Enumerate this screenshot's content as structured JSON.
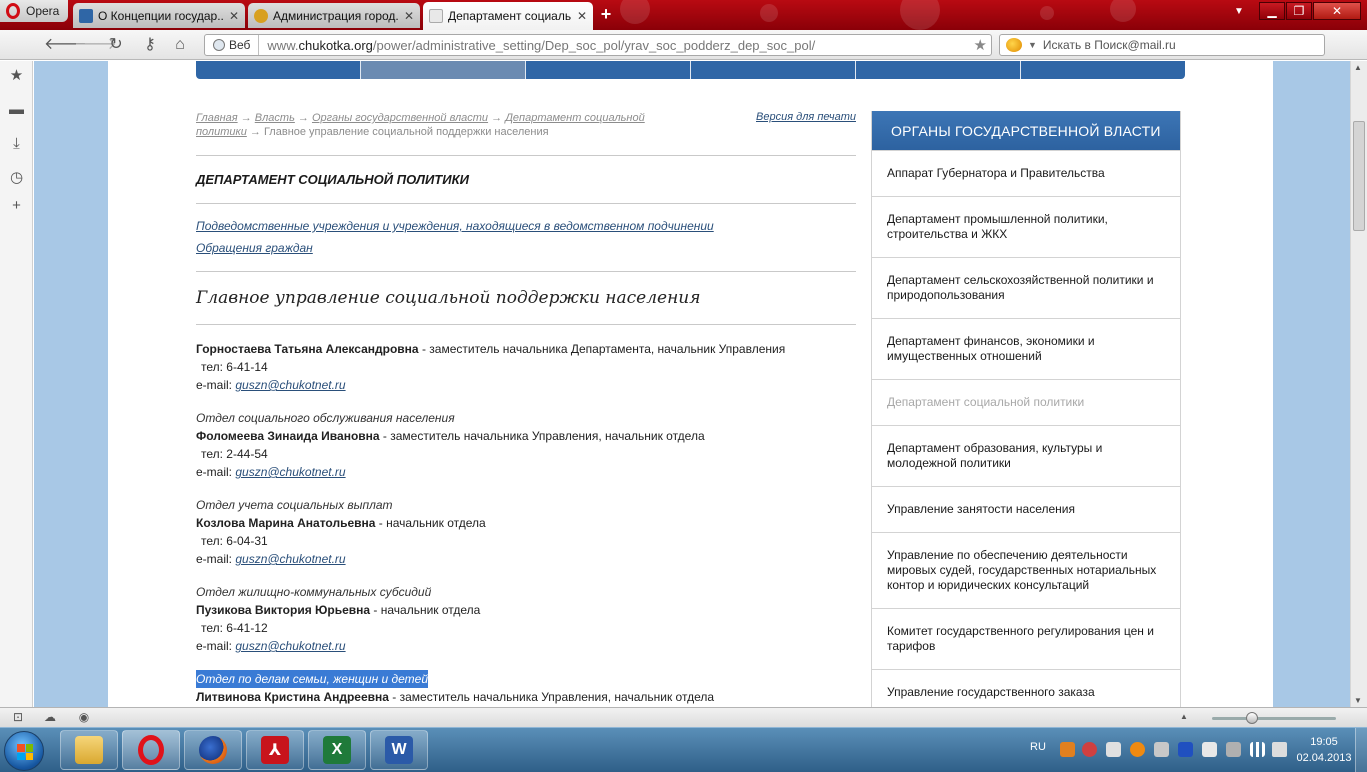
{
  "browser": {
    "menu_label": "Opera",
    "tabs": [
      {
        "title": "О Концепции государ...",
        "favicon_color": "#2f66a6"
      },
      {
        "title": "Администрация город...",
        "favicon_color": "#d8a020"
      },
      {
        "title": "Департамент социаль...",
        "favicon_color": "#cccccc",
        "active": true
      }
    ],
    "new_tab_label": "+",
    "address": {
      "badge": "Веб",
      "url_prefix": "www.",
      "url_domain": "chukotka.org",
      "url_path": "/power/administrative_setting/Dep_soc_pol/yrav_soc_podderz_dep_soc_pol/"
    },
    "search_placeholder": "Искать в Поиск@mail.ru"
  },
  "page": {
    "breadcrumb": {
      "items": [
        "Главная",
        "Власть",
        "Органы государственной власти",
        "Департамент социальной политики"
      ],
      "separator": "→",
      "current": "Главное управление социальной поддержки населения"
    },
    "print_link": "Версия для печати",
    "dept_title": "ДЕПАРТАМЕНТ СОЦИАЛЬНОЙ ПОЛИТИКИ",
    "links": [
      "Подведомственные учреждения и учреждения, находящиеся в ведомственном подчинении",
      "Обращения граждан"
    ],
    "section_title": "Главное управление социальной поддержки населения",
    "contacts": [
      {
        "dept": "",
        "name": "Горностаева Татьяна Александровна",
        "role": " - заместитель начальника Департамента, начальник Управления",
        "phone": "тел: 6-41-14",
        "email_label": "e-mail: ",
        "email": "guszn@chukotnet.ru"
      },
      {
        "dept": "Отдел социального обслуживания населения",
        "name": "Фоломеева Зинаида Ивановна",
        "role": " - заместитель начальника Управления, начальник отдела",
        "phone": "тел: 2-44-54",
        "email_label": "e-mail: ",
        "email": "guszn@chukotnet.ru"
      },
      {
        "dept": "Отдел учета социальных выплат",
        "name": "Козлова Марина Анатольевна",
        "role": " - начальник отдела",
        "phone": "тел: 6-04-31",
        "email_label": "e-mail: ",
        "email": "guszn@chukotnet.ru"
      },
      {
        "dept": "Отдел жилищно-коммунальных субсидий",
        "name": "Пузикова Виктория Юрьевна",
        "role": " - начальник отдела",
        "phone": "тел: 6-41-12",
        "email_label": "e-mail: ",
        "email": "guszn@chukotnet.ru"
      },
      {
        "dept": "Отдел по делам семьи, женщин и детей",
        "name": "Литвинова Кристина Андреевна",
        "role": " - заместитель начальника Управления, начальник отдела",
        "highlighted": true
      }
    ]
  },
  "sidebar": {
    "header": "ОРГАНЫ ГОСУДАРСТВЕННОЙ ВЛАСТИ",
    "items": [
      {
        "label": "Аппарат Губернатора и Правительства"
      },
      {
        "label": "Департамент промышленной политики, строительства и ЖКХ"
      },
      {
        "label": "Департамент сельскохозяйственной политики и природопользования"
      },
      {
        "label": "Департамент финансов, экономики и имущественных отношений"
      },
      {
        "label": "Департамент социальной политики",
        "current": true
      },
      {
        "label": "Департамент образования, культуры и молодежной политики"
      },
      {
        "label": "Управление занятости населения"
      },
      {
        "label": "Управление по обеспечению деятельности мировых судей, государственных нотариальных контор и юридических консультаций"
      },
      {
        "label": "Комитет государственного регулирования цен и тарифов"
      },
      {
        "label": "Управление государственного заказа"
      }
    ]
  },
  "taskbar": {
    "lang": "RU",
    "time": "19:05",
    "date": "02.04.2013",
    "apps": [
      "explorer-icon",
      "opera-icon",
      "firefox-icon",
      "acrobat-icon",
      "excel-icon",
      "word-icon"
    ]
  },
  "colors": {
    "brand_blue": "#2f66a6",
    "opera_red": "#b90a12",
    "link": "#2a4f7a",
    "selection": "#3a7bd5"
  }
}
